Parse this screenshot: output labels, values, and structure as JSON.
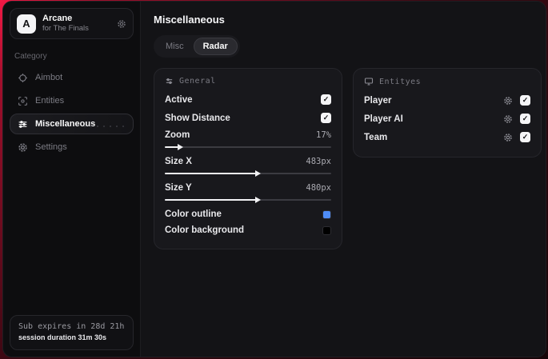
{
  "icons": {
    "check": "✓"
  },
  "colors": {
    "accent": "#e3163e",
    "outline_swatch": "#4f8df7",
    "background_swatch": "#000000"
  },
  "sidebar": {
    "logo_letter": "A",
    "title": "Arcane",
    "subtitle": "for The Finals",
    "category_label": "Category",
    "items": [
      {
        "label": "Aimbot"
      },
      {
        "label": "Entities"
      },
      {
        "label": "Miscellaneous"
      },
      {
        "label": "Settings"
      }
    ],
    "footer": {
      "line1": "Sub expires in 28d 21h",
      "line2": "session duration 31m 30s"
    }
  },
  "main": {
    "title": "Miscellaneous",
    "tabs": [
      {
        "label": "Misc"
      },
      {
        "label": "Radar"
      }
    ],
    "general": {
      "header": "General",
      "toggles": [
        {
          "label": "Active",
          "checked": true
        },
        {
          "label": "Show Distance",
          "checked": true
        }
      ],
      "sliders": [
        {
          "label": "Zoom",
          "value": "17%",
          "fill_pct": 8
        },
        {
          "label": "Size X",
          "value": "483px",
          "fill_pct": 55
        },
        {
          "label": "Size Y",
          "value": "480px",
          "fill_pct": 55
        }
      ],
      "color_rows": [
        {
          "label": "Color outline",
          "swatch": "#4f8df7"
        },
        {
          "label": "Color background",
          "swatch": "#000000"
        }
      ]
    },
    "entities": {
      "header": "Entityes",
      "rows": [
        {
          "label": "Player",
          "checked": true
        },
        {
          "label": "Player AI",
          "checked": true
        },
        {
          "label": "Team",
          "checked": true
        }
      ]
    }
  }
}
